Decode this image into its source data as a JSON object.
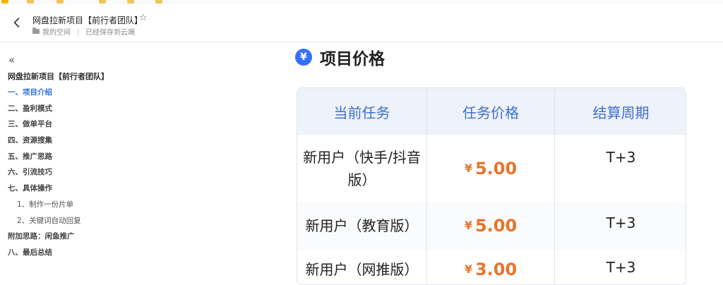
{
  "header": {
    "doc_title": "网盘拉新项目【前行者团队】",
    "breadcrumb_space": "我的空间",
    "save_status": "已经保存到云端"
  },
  "outline": {
    "title": "网盘拉新项目【前行者团队】",
    "items": [
      {
        "label": "一、项目介绍",
        "level": 1,
        "active": true
      },
      {
        "label": "二、盈利模式",
        "level": 1
      },
      {
        "label": "三、做单平台",
        "level": 1
      },
      {
        "label": "四、资源搜集",
        "level": 1
      },
      {
        "label": "五、推广思路",
        "level": 1
      },
      {
        "label": "六、引流技巧",
        "level": 1
      },
      {
        "label": "七、具体操作",
        "level": 1
      },
      {
        "label": "1、制作一份片单",
        "level": 2
      },
      {
        "label": "2、关键词自动回复",
        "level": 2
      },
      {
        "label": "附加思路：闲鱼推广",
        "level": 1
      },
      {
        "label": "八、最后总结",
        "level": 1
      }
    ]
  },
  "section": {
    "icon_symbol": "¥",
    "heading": "项目价格"
  },
  "table": {
    "headers": [
      "当前任务",
      "任务价格",
      "结算周期"
    ],
    "rows": [
      {
        "task_line1": "新用户（快手/抖音",
        "task_line2": "版）",
        "currency": "¥",
        "price": "5.00",
        "cycle": "T+3"
      },
      {
        "task_line1": "新用户（教育版）",
        "task_line2": "",
        "currency": "¥",
        "price": "5.00",
        "cycle": "T+3"
      },
      {
        "task_line1": "新用户（网推版）",
        "task_line2": "",
        "currency": "¥",
        "price": "3.00",
        "cycle": "T+3"
      }
    ]
  },
  "colors": {
    "accent": "#3370ff",
    "header_text": "#3f6fcf",
    "header_bg": "#eef2fa",
    "price": "#e8742b",
    "active_outline": "#2f6fdf"
  },
  "icons": [
    "back-arrow-icon",
    "star-icon",
    "folder-icon",
    "collapse-icon",
    "yen-icon"
  ]
}
